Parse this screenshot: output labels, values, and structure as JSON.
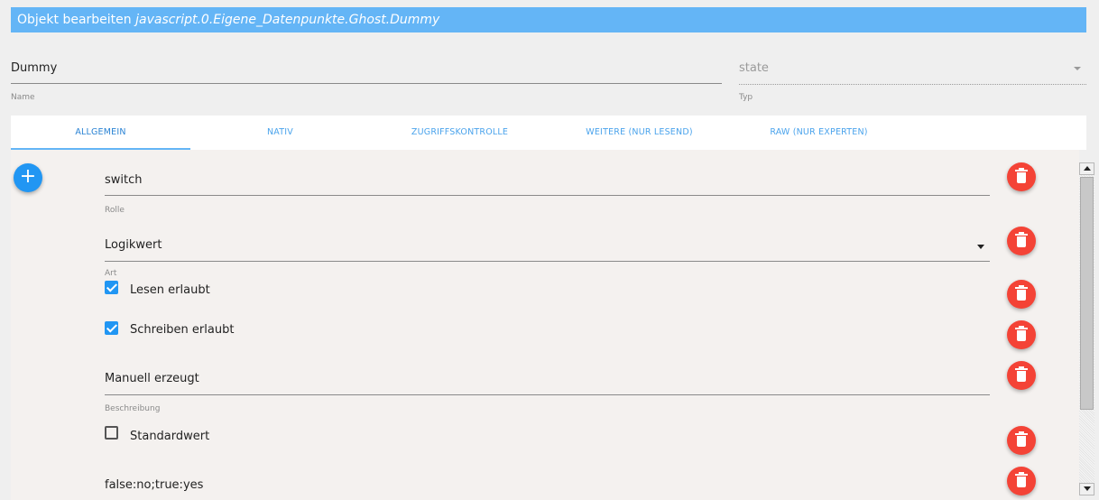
{
  "dialog": {
    "title_prefix": "Objekt bearbeiten",
    "title_path": "javascript.0.Eigene_Datenpunkte.Ghost.Dummy"
  },
  "header": {
    "name_value": "Dummy",
    "name_label": "Name",
    "type_value": "state",
    "type_label": "Typ"
  },
  "tabs": [
    {
      "label": "ALLGEMEIN",
      "active": true
    },
    {
      "label": "NATIV"
    },
    {
      "label": "ZUGRIFFSKONTROLLE"
    },
    {
      "label": "WEITERE (NUR LESEND)"
    },
    {
      "label": "RAW (NUR EXPERTEN)"
    }
  ],
  "fields": {
    "role": {
      "value": "switch",
      "label": "Rolle"
    },
    "type": {
      "value": "Logikwert",
      "label": "Art"
    },
    "read": {
      "label": "Lesen erlaubt",
      "checked": true
    },
    "write": {
      "label": "Schreiben erlaubt",
      "checked": true
    },
    "desc": {
      "value": "Manuell erzeugt",
      "label": "Beschreibung"
    },
    "default": {
      "label": "Standardwert",
      "checked": false
    },
    "states": {
      "value": "false:no;true:yes"
    }
  },
  "icons": {
    "add": "plus-icon",
    "delete": "trash-icon"
  },
  "colors": {
    "accent": "#64b5f6",
    "primary": "#2196f3",
    "delete": "#f44336"
  }
}
